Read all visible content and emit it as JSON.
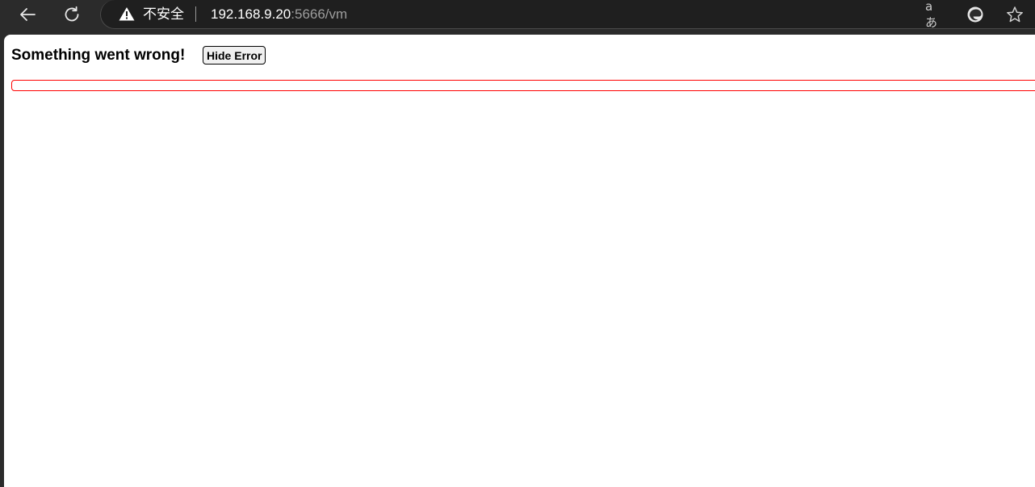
{
  "browser": {
    "security_label": "不安全",
    "url_host": "192.168.9.20",
    "url_rest": ":5666/vm",
    "read_aloud_label": "aあ",
    "icons": {
      "back": "back-arrow-icon",
      "reload": "reload-icon",
      "warning": "warning-triangle-icon",
      "read_aloud": "read-aloud-icon",
      "edge": "edge-logo-icon",
      "favorite": "star-icon"
    }
  },
  "page": {
    "error_title": "Something went wrong!",
    "hide_button_label": "Hide Error",
    "error_details": "",
    "colors": {
      "error_border": "#ff0000"
    }
  }
}
